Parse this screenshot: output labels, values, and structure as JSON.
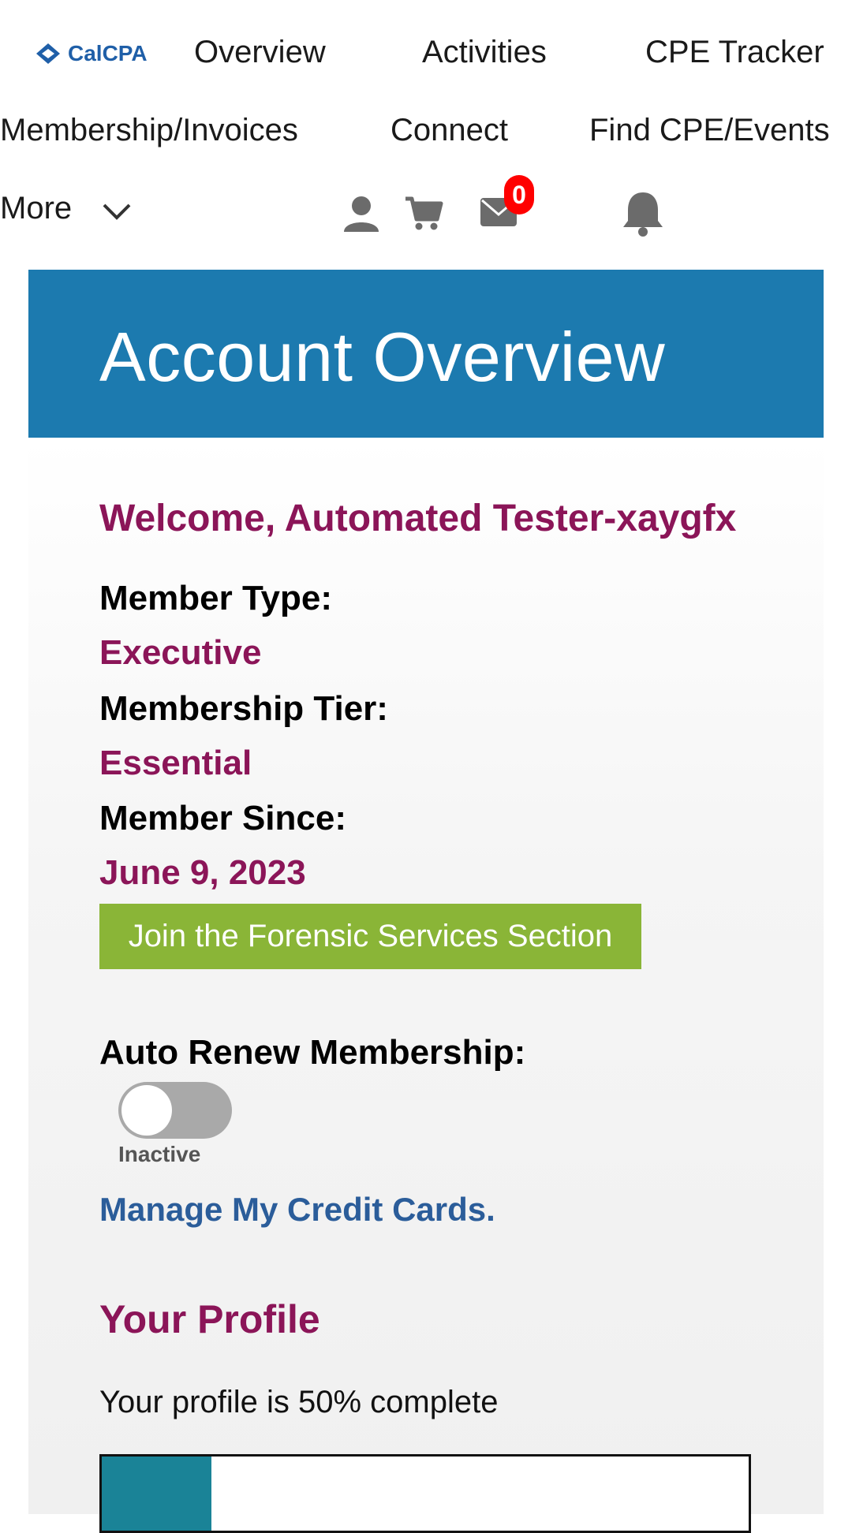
{
  "header": {
    "logo_text": "CalCPA",
    "nav": [
      "Overview",
      "Activities",
      "CPE Tracker",
      "Membership/Invoices",
      "Connect",
      "Find CPE/Events",
      "More"
    ],
    "icons": [
      "user-icon",
      "cart-icon",
      "mail-icon",
      "bell-icon"
    ],
    "mail_badge": "0"
  },
  "banner": {
    "title": "Account Overview",
    "color": "#1c7aaf"
  },
  "account": {
    "welcome": "Welcome, Automated Tester-xaygfx",
    "member_type_label": "Member Type:",
    "member_type": "Executive",
    "tier_label": "Membership Tier:",
    "tier": "Essential",
    "since_label": "Member Since:",
    "since": "June 9, 2023",
    "join_button": "Join the Forensic Services Section",
    "auto_renew_label": "Auto Renew Membership:",
    "auto_renew_status": "Inactive",
    "auto_renew_on": false,
    "credit_cards_link": "Manage My Credit Cards."
  },
  "profile": {
    "heading": "Your Profile",
    "completion_text": "Your profile is 50% complete",
    "progress_percent": 50
  },
  "colors": {
    "accent": "#8b1558",
    "button": "#8ab537",
    "progress": "#1a8397",
    "link": "#2b5d9a"
  }
}
